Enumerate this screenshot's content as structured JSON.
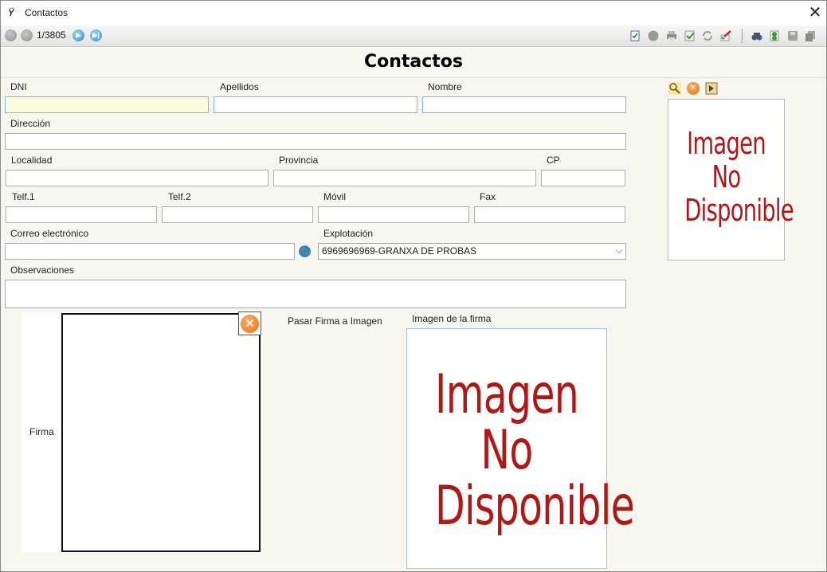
{
  "window": {
    "title": "Contactos",
    "app_icon": "app-logo-icon"
  },
  "toolbar": {
    "record_position": "1/3805",
    "nav_icons": [
      "first-record-icon",
      "previous-record-icon",
      "next-record-icon",
      "last-record-icon"
    ],
    "action_icons": [
      "new-record-icon",
      "delete-icon",
      "print-icon",
      "validate-icon",
      "refresh-icon",
      "edit-icon",
      "search-icon",
      "export-icon",
      "save-icon",
      "copy-icon"
    ]
  },
  "form": {
    "title": "Contactos",
    "dni_label": "DNI",
    "apellidos_label": "Apellidos",
    "nombre_label": "Nombre",
    "direccion_label": "Dirección",
    "localidad_label": "Localidad",
    "provincia_label": "Provincia",
    "cp_label": "CP",
    "telf1_label": "Telf.1",
    "telf2_label": "Telf.2",
    "movil_label": "Móvil",
    "fax_label": "Fax",
    "correo_label": "Correo electrónico",
    "explotacion_label": "Explotación",
    "explotacion_value": "6969696969-GRANXA DE PROBAS",
    "observaciones_label": "Observaciones",
    "firma_label": "Firma",
    "pasar_firma_label": "Pasar Firma a Imagen",
    "imagen_firma_label": "Imagen de la firma",
    "placeholder_image": {
      "line1": "Imagen",
      "line2": "No",
      "line3": "Disponible"
    }
  },
  "colors": {
    "accent_blue": "#2a8cc8",
    "active_field": "#fdfde2",
    "placeholder_red": "#b01818",
    "form_bg": "#f7f6ef",
    "clear_orange": "#e66f0a"
  }
}
